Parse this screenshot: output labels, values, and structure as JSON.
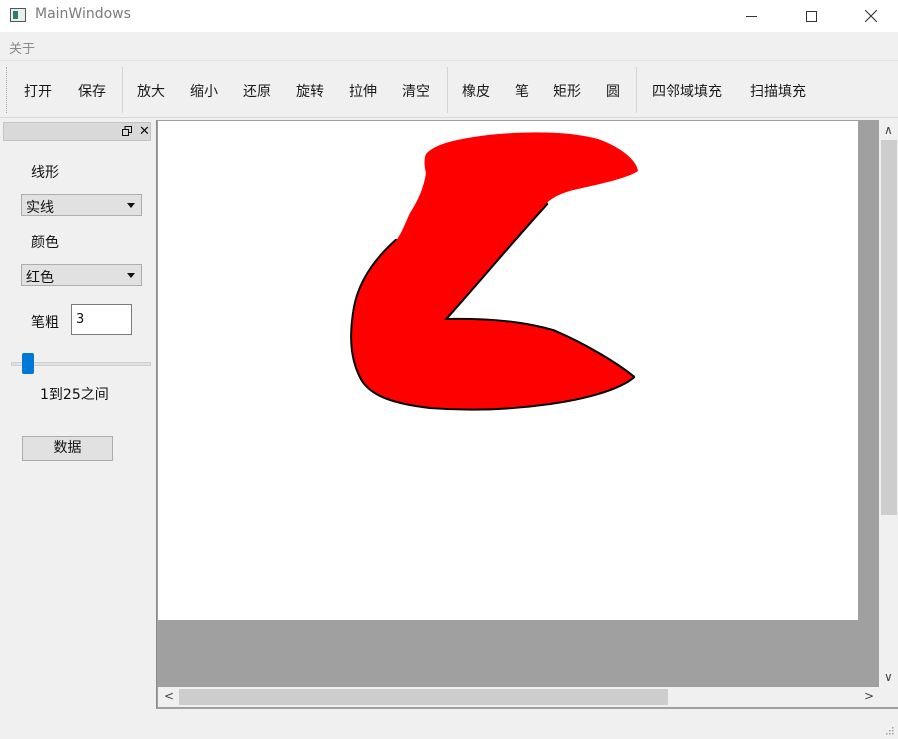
{
  "window": {
    "title": "MainWindows"
  },
  "menu": {
    "items": [
      "关于"
    ]
  },
  "toolbar": {
    "open": "打开",
    "save": "保存",
    "zoom_in": "放大",
    "zoom_out": "缩小",
    "restore": "还原",
    "rotate": "旋转",
    "stretch": "拉伸",
    "clear": "清空",
    "eraser": "橡皮",
    "pen": "笔",
    "rectangle": "矩形",
    "circle": "圆",
    "flood_fill_4": "四邻域填充",
    "scanline_fill": "扫描填充"
  },
  "dock": {
    "line_style_label": "线形",
    "line_style_value": "实线",
    "color_label": "颜色",
    "color_value": "红色",
    "pen_width_label": "笔粗",
    "pen_width_value": "3",
    "slider_level": 3,
    "slider_range_text": "1到25之间",
    "data_button": "数据"
  },
  "canvas": {
    "background": "#ffffff",
    "stroke_fill_color": "#ff0000",
    "stroke_outline_color": "#000000"
  }
}
